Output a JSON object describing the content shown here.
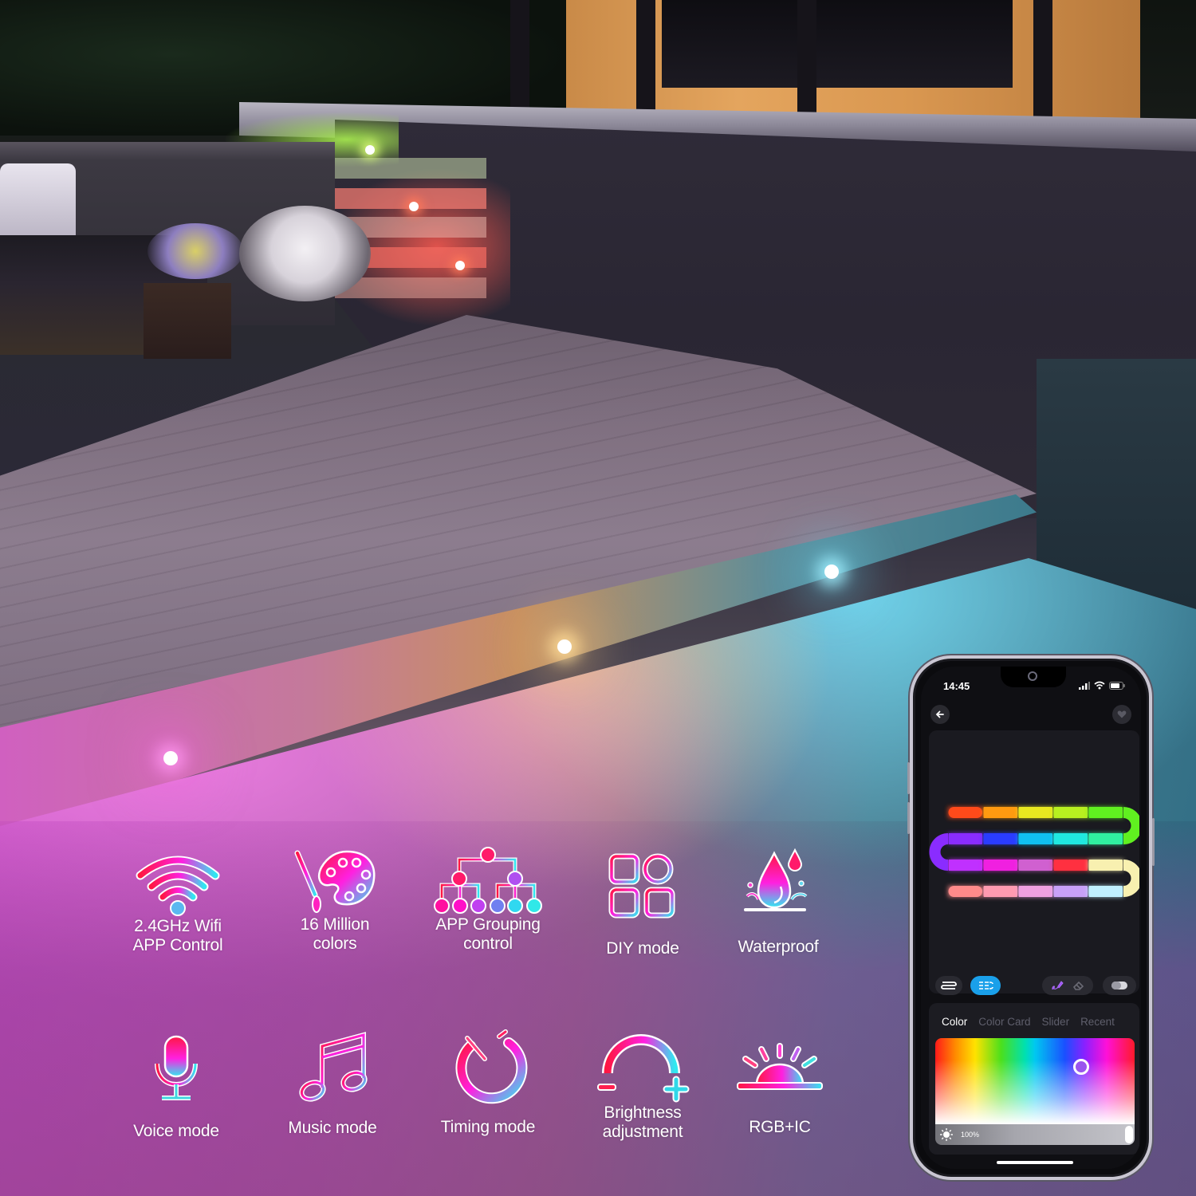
{
  "features": [
    {
      "id": "wifi",
      "icon": "wifi-icon",
      "lines": [
        "2.4GHz Wifi",
        "APP Control"
      ]
    },
    {
      "id": "colors",
      "icon": "palette-icon",
      "lines": [
        "16 Million",
        "colors"
      ]
    },
    {
      "id": "grouping",
      "icon": "grouping-tree-icon",
      "lines": [
        "APP Grouping",
        "control"
      ]
    },
    {
      "id": "diy",
      "icon": "diy-grid-icon",
      "lines": [
        "DIY mode"
      ]
    },
    {
      "id": "waterproof",
      "icon": "water-drop-icon",
      "lines": [
        "Waterproof"
      ]
    },
    {
      "id": "voice",
      "icon": "microphone-icon",
      "lines": [
        "Voice mode"
      ]
    },
    {
      "id": "music",
      "icon": "music-note-icon",
      "lines": [
        "Music mode"
      ]
    },
    {
      "id": "timing",
      "icon": "timer-icon",
      "lines": [
        "Timing mode"
      ]
    },
    {
      "id": "brightness",
      "icon": "brightness-arc-icon",
      "lines": [
        "Brightness",
        "adjustment"
      ]
    },
    {
      "id": "rgbic",
      "icon": "sunrise-icon",
      "lines": [
        "RGB+IC"
      ]
    }
  ],
  "phone": {
    "status_time": "14:45",
    "status_icons": [
      "signal-icon",
      "wifi-icon",
      "battery-icon"
    ],
    "back_icon": "back-arrow-icon",
    "favorite_icon": "heart-icon",
    "mode_buttons": [
      {
        "icon": "strip-single-icon",
        "active": false
      },
      {
        "icon": "strip-segments-icon",
        "active": true
      },
      {
        "icon": "paint-brush-icon",
        "active": false
      },
      {
        "icon": "eraser-icon",
        "active": false
      },
      {
        "icon": "toggle-icon",
        "active": false
      }
    ],
    "tabs": [
      {
        "label": "Color",
        "active": true
      },
      {
        "label": "Color Card",
        "active": false
      },
      {
        "label": "Slider",
        "active": false
      },
      {
        "label": "Recent",
        "active": false
      }
    ],
    "selected_color": "#9a55ee",
    "picker_position": {
      "hue_fraction": 0.73,
      "saturation_fraction": 0.33
    },
    "brightness": {
      "value": 100,
      "label": "100%"
    },
    "strip_preview_colors": [
      [
        "#ff4a1a",
        "#ff9a10",
        "#e8e820",
        "#b8f020",
        "#60f020"
      ],
      [
        "#8a2cff",
        "#2a3cff",
        "#10c0f0",
        "#20e8e0",
        "#30f0a0"
      ],
      [
        "#c030ff",
        "#f020e0",
        "#d060d0",
        "#ff3040",
        "#f8f0b0"
      ],
      [
        "#ff8a8a",
        "#ff9ab0",
        "#f0a0e0",
        "#c8a0f8",
        "#c0f0ff"
      ]
    ]
  }
}
